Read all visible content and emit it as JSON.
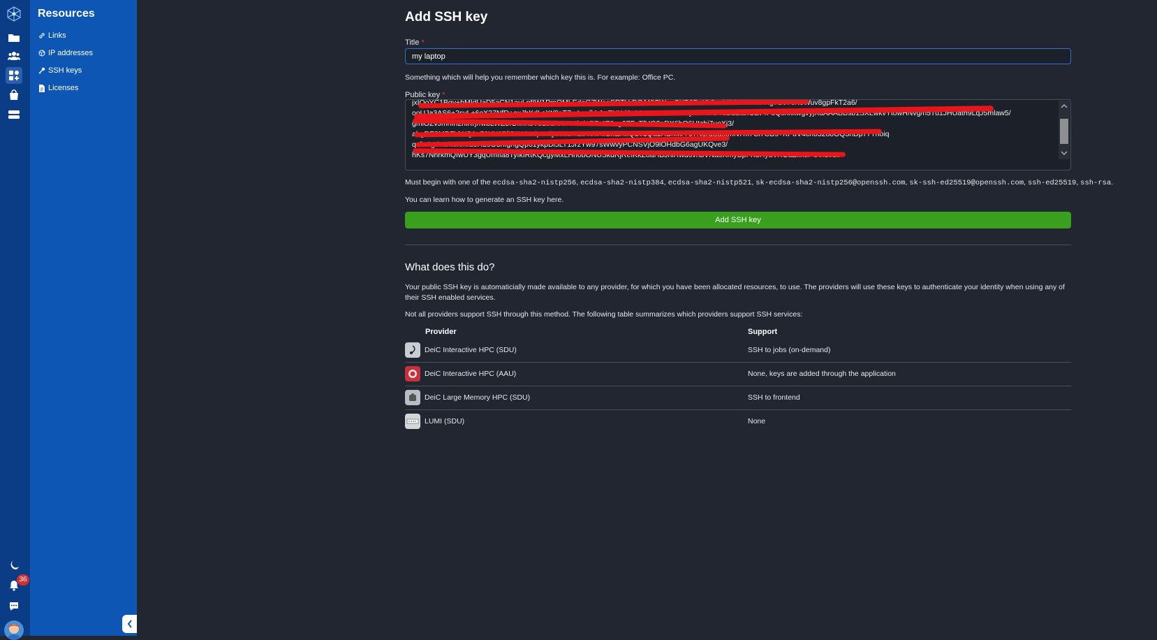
{
  "sidebar": {
    "title": "Resources",
    "items": [
      {
        "label": "Links",
        "icon": "link-icon"
      },
      {
        "label": "IP addresses",
        "icon": "globe-icon"
      },
      {
        "label": "SSH keys",
        "icon": "key-icon"
      },
      {
        "label": "Licenses",
        "icon": "document-icon"
      }
    ]
  },
  "rail": {
    "notification_count": "36",
    "icons": [
      "logo-icon",
      "folder-icon",
      "users-icon",
      "resources-icon",
      "shop-icon",
      "storage-icon",
      "moon-icon",
      "bell-icon",
      "chat-icon",
      "avatar"
    ]
  },
  "form": {
    "heading": "Add SSH key",
    "title_label": "Title",
    "title_value": "my laptop",
    "title_hint": "Something which will help you remember which key this is. For example: Office PC.",
    "key_label": "Public key",
    "key_lines": [
      "jxIOoYC1Bgv+bMIdUaD5aCN1auLpfIW1PmOMLEdeG7WeeSRTkkDCJ48SWveCXP6PoIGCnsLliVMt70nnPKgTB97cKeWuv8gpFkT2a6/",
      "ooUJa3AS6+2svL+6eX27NfD+oxJbKdLsXt/9pT7mLozfkLAeEYXdJa98vKPXWXvFe8yveG1/GYaB22laxGZv4FuQsnxkwgvyjXdAAABBsb1SXLwkvYtowHNvg/n5Tu1JHUath9LqJ5mlaw5/",
      "gmiOZvJmhIh2hiKrjrfwbLWZ5IGfInhbVuLbLlCSXMhdnR7r4E9xg6ZFsTfUG2pDX6hQ6HIzhi7uoXj3/",
      "ahgDE0MDFVWQ1n72XY05fI5IIKCedp6rdy5c3DYZ34ovAv1wZHkQBv1Qa1HBnMrY67NoruSdotmN7m7Cl7CB9+KPuV4ch032o8OQ3nDp77Thoiq",
      "qzlic2gdKDkdI0nfueHLoO5nfgngQp61ykpDl5LT1JrzYw97sWwvyPCNSVjO9lOHdbG6agUKQve3/",
      "hKs7NhrkmQIwUY3gqUmIfa8TyfkIRtKQcgyMxLHh0bONUSkdRjReIKkZoaHBJnlRwd6vhbVNa0XmyBpFK3HyuVXGaZkk8PC0f1919"
    ],
    "key_prefix": "Must begin with one of the",
    "key_types": [
      "ecdsa-sha2-nistp256",
      "ecdsa-sha2-nistp384",
      "ecdsa-sha2-nistp521",
      "sk-ecdsa-sha2-nistp256@openssh.com",
      "sk-ssh-ed25519@openssh.com",
      "ssh-ed25519",
      "ssh-rsa"
    ],
    "learn_text": "You can learn how to generate an SSH key here.",
    "submit_label": "Add SSH key"
  },
  "info": {
    "heading": "What does this do?",
    "para1": "Your public SSH key is automaticially made available to any provider, for which you have been allocated resources, to use. The providers will use these keys to authenticate your identity when using any of their SSH enabled services.",
    "para2": "Not all providers support SSH through this method. The following table summarizes which providers support SSH services:",
    "columns": [
      "Provider",
      "Support"
    ],
    "rows": [
      {
        "provider": "DeiC Interactive HPC (SDU)",
        "support": "SSH to jobs (on-demand)",
        "logo_color": "#c9ccd2"
      },
      {
        "provider": "DeiC Interactive HPC (AAU)",
        "support": "None, keys are added through the application",
        "logo_color": "#c8303e"
      },
      {
        "provider": "DeiC Large Memory HPC (SDU)",
        "support": "SSH to frontend",
        "logo_color": "#b9bcc2"
      },
      {
        "provider": "LUMI (SDU)",
        "support": "None",
        "logo_color": "#d4d6da"
      }
    ]
  },
  "colors": {
    "accent": "#0e56b3",
    "rail": "#0a3d86",
    "button": "#38a01d",
    "background": "#212630",
    "redaction": "#e8151a"
  }
}
